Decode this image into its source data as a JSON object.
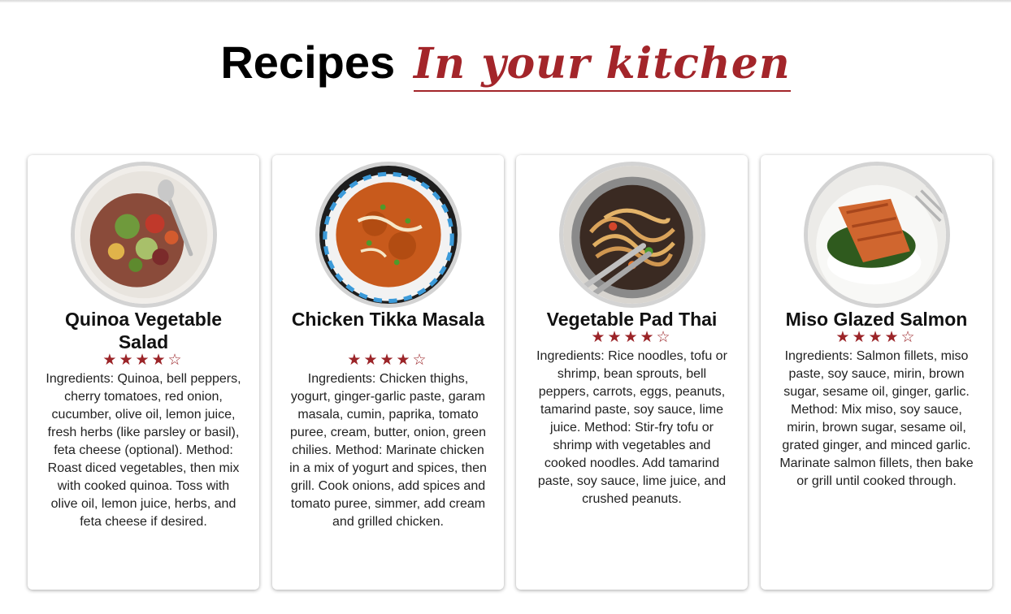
{
  "header": {
    "title_plain": "Recipes",
    "title_script": "In your kitchen",
    "accent_color": "#a3252a"
  },
  "recipes": [
    {
      "title": "Quinoa Vegetable Salad",
      "rating_stars": "★★★★",
      "rating": 4.5,
      "image": "quinoa-salad-plate-image",
      "description": "Ingredients: Quinoa, bell peppers, cherry tomatoes, red onion, cucumber, olive oil, lemon juice, fresh herbs (like parsley or basil), feta cheese (optional). Method: Roast diced vegetables, then mix with cooked quinoa. Toss with olive oil, lemon juice, herbs, and feta cheese if desired."
    },
    {
      "title": "Chicken Tikka Masala",
      "rating_stars": "★★★★",
      "rating": 4.5,
      "image": "tikka-masala-bowl-image",
      "description": "Ingredients: Chicken thighs, yogurt, ginger-garlic paste, garam masala, cumin, paprika, tomato puree, cream, butter, onion, green chilies. Method: Marinate chicken in a mix of yogurt and spices, then grill. Cook onions, add spices and tomato puree, simmer, add cream and grilled chicken."
    },
    {
      "title": "Vegetable Pad Thai",
      "rating_stars": "★★★★",
      "rating": 4.5,
      "image": "pad-thai-pan-image",
      "description": "Ingredients: Rice noodles, tofu or shrimp, bean sprouts, bell peppers, carrots, eggs, peanuts, tamarind paste, soy sauce, lime juice. Method: Stir-fry tofu or shrimp with vegetables and cooked noodles. Add tamarind paste, soy sauce, lime juice, and crushed peanuts."
    },
    {
      "title": "Miso Glazed Salmon",
      "rating_stars": "★★★★",
      "rating": 4.5,
      "image": "miso-salmon-plate-image",
      "description": "Ingredients: Salmon fillets, miso paste, soy sauce, mirin, brown sugar, sesame oil, ginger, garlic. Method: Mix miso, soy sauce, mirin, brown sugar, sesame oil, grated ginger, and minced garlic. Marinate salmon fillets, then bake or grill until cooked through."
    }
  ]
}
